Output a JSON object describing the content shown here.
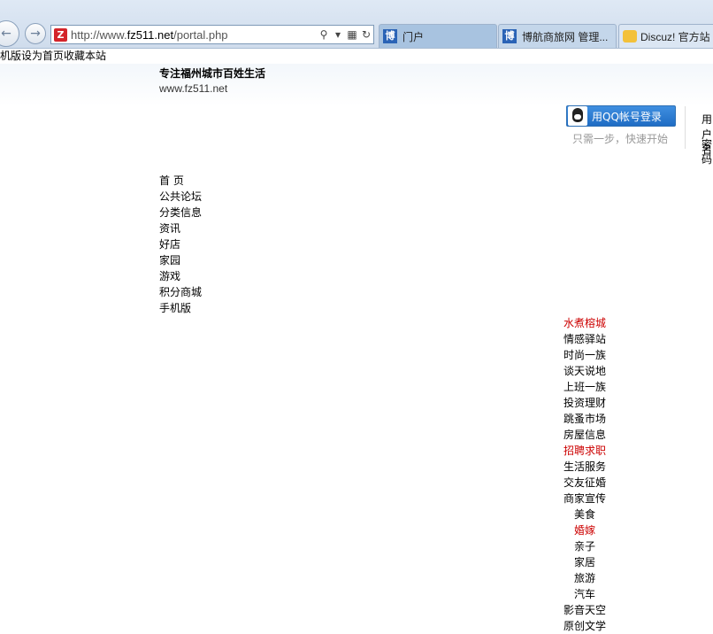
{
  "browser": {
    "url_prefix": "http://www.",
    "url_domain": "fz511.net",
    "url_path": "/portal.php",
    "site_icon_char": "Z",
    "tabs": [
      {
        "icon": "博",
        "label": "门户"
      },
      {
        "icon": "博",
        "label": "博航商旅网 管理..."
      },
      {
        "icon": "",
        "label": "Discuz! 官方站"
      }
    ]
  },
  "topbar": {
    "set_home": "机版设为首页",
    "bookmark": "收藏本站"
  },
  "header": {
    "slogan": "专注福州城市百姓生活",
    "site_url": "www.fz511.net"
  },
  "login": {
    "qq_button": "用QQ帐号登录",
    "qq_note": "只需一步，快速开始",
    "user_label": "用户名",
    "pass_label": "密码"
  },
  "nav": [
    "首 页",
    "公共论坛",
    "分类信息",
    "资讯",
    "好店",
    "家园",
    "游戏",
    "积分商城",
    "手机版"
  ],
  "forum": [
    {
      "label": "水煮榕城",
      "red": true,
      "sub": false
    },
    {
      "label": "情感驿站",
      "red": false,
      "sub": false
    },
    {
      "label": "时尚一族",
      "red": false,
      "sub": false
    },
    {
      "label": "谈天说地",
      "red": false,
      "sub": false
    },
    {
      "label": "上班一族",
      "red": false,
      "sub": false
    },
    {
      "label": "投资理财",
      "red": false,
      "sub": false
    },
    {
      "label": "跳蚤市场",
      "red": false,
      "sub": false
    },
    {
      "label": "房屋信息",
      "red": false,
      "sub": false
    },
    {
      "label": "招聘求职",
      "red": true,
      "sub": false
    },
    {
      "label": "生活服务",
      "red": false,
      "sub": false
    },
    {
      "label": "交友征婚",
      "red": false,
      "sub": false
    },
    {
      "label": "商家宣传",
      "red": false,
      "sub": false
    },
    {
      "label": "美食",
      "red": false,
      "sub": true
    },
    {
      "label": "婚嫁",
      "red": true,
      "sub": true
    },
    {
      "label": "亲子",
      "red": false,
      "sub": true
    },
    {
      "label": "家居",
      "red": false,
      "sub": true
    },
    {
      "label": "旅游",
      "red": false,
      "sub": true
    },
    {
      "label": "汽车",
      "red": false,
      "sub": true
    },
    {
      "label": "影音天空",
      "red": false,
      "sub": false
    },
    {
      "label": "原创文学",
      "red": false,
      "sub": false
    }
  ]
}
